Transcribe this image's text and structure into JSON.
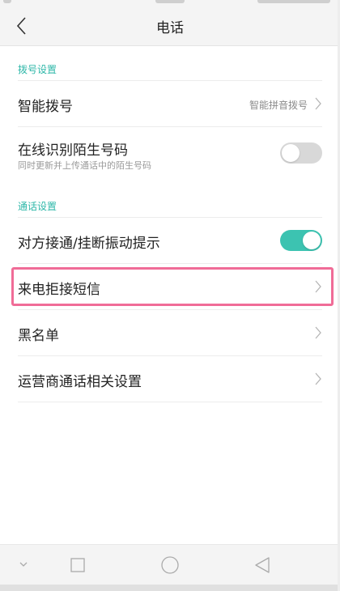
{
  "header": {
    "title": "电话",
    "back_icon": "chevron-left-icon"
  },
  "sections": [
    {
      "label": "拨号设置",
      "items": [
        {
          "label": "智能拨号",
          "value": "智能拼音拨号",
          "control": "chevron"
        },
        {
          "label": "在线识别陌生号码",
          "subtitle": "同时更新并上传通话中的陌生号码",
          "control": "toggle",
          "on": false
        }
      ]
    },
    {
      "label": "通话设置",
      "items": [
        {
          "label": "对方接通/挂断振动提示",
          "control": "toggle",
          "on": true
        },
        {
          "label": "来电拒接短信",
          "control": "chevron"
        },
        {
          "label": "黑名单",
          "control": "chevron",
          "highlighted": true
        },
        {
          "label": "运营商通话相关设置",
          "control": "chevron"
        }
      ]
    }
  ],
  "colors": {
    "accent": "#3cc3b1",
    "section_label": "#2db7a8",
    "highlight": "#f06c97",
    "toggle_off": "#d8d8d8"
  },
  "navbar": {
    "icons": [
      "chevron-down-icon",
      "square-icon",
      "circle-icon",
      "triangle-back-icon"
    ]
  }
}
